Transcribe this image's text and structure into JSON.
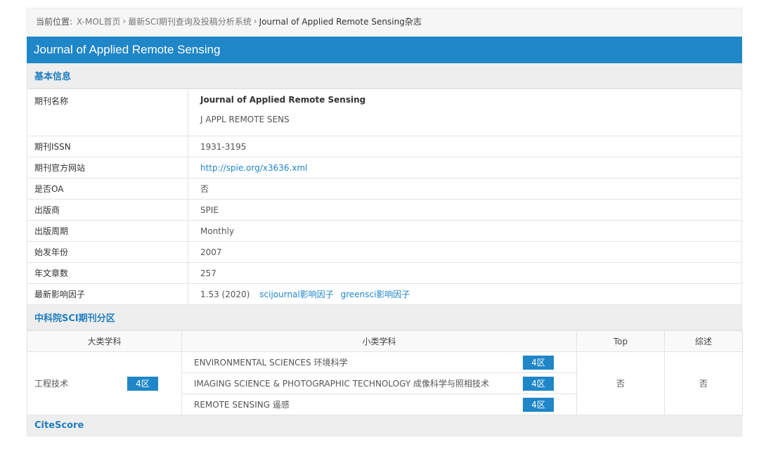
{
  "breadcrumb": {
    "label": "当前位置:",
    "items": [
      "X-MOL首页",
      "最新SCI期刊查询及投稿分析系统",
      "Journal of Applied Remote Sensing杂志"
    ],
    "separator": "›"
  },
  "title": "Journal of Applied Remote Sensing",
  "basic_info": {
    "heading": "基本信息",
    "name_label": "期刊名称",
    "name_main": "Journal of Applied Remote Sensing",
    "name_abbr": "J APPL REMOTE SENS",
    "issn_label": "期刊ISSN",
    "issn": "1931-3195",
    "website_label": "期刊官方网站",
    "website": "http://spie.org/x3636.xml",
    "oa_label": "是否OA",
    "oa": "否",
    "publisher_label": "出版商",
    "publisher": "SPIE",
    "frequency_label": "出版周期",
    "frequency": "Monthly",
    "start_year_label": "始发年份",
    "start_year": "2007",
    "articles_label": "年文章数",
    "articles": "257",
    "if_label": "最新影响因子",
    "if_value": "1.53 (2020)",
    "if_link1": "scijournal影响因子",
    "if_link2": "greensci影响因子"
  },
  "cas_zone": {
    "heading": "中科院SCI期刊分区",
    "headers": [
      "大类学科",
      "小类学科",
      "Top",
      "综述"
    ],
    "major": "工程技术",
    "major_zone": "4区",
    "subs": [
      {
        "name": "ENVIRONMENTAL SCIENCES 环境科学",
        "zone": "4区"
      },
      {
        "name": "IMAGING SCIENCE & PHOTOGRAPHIC TECHNOLOGY 成像科学与照相技术",
        "zone": "4区"
      },
      {
        "name": "REMOTE SENSING 遥感",
        "zone": "4区"
      }
    ],
    "top": "否",
    "review": "否"
  },
  "citescore": {
    "heading": "CiteScore"
  },
  "colors": {
    "accent": "#1f86c8",
    "section_text": "#1f7ec1"
  }
}
